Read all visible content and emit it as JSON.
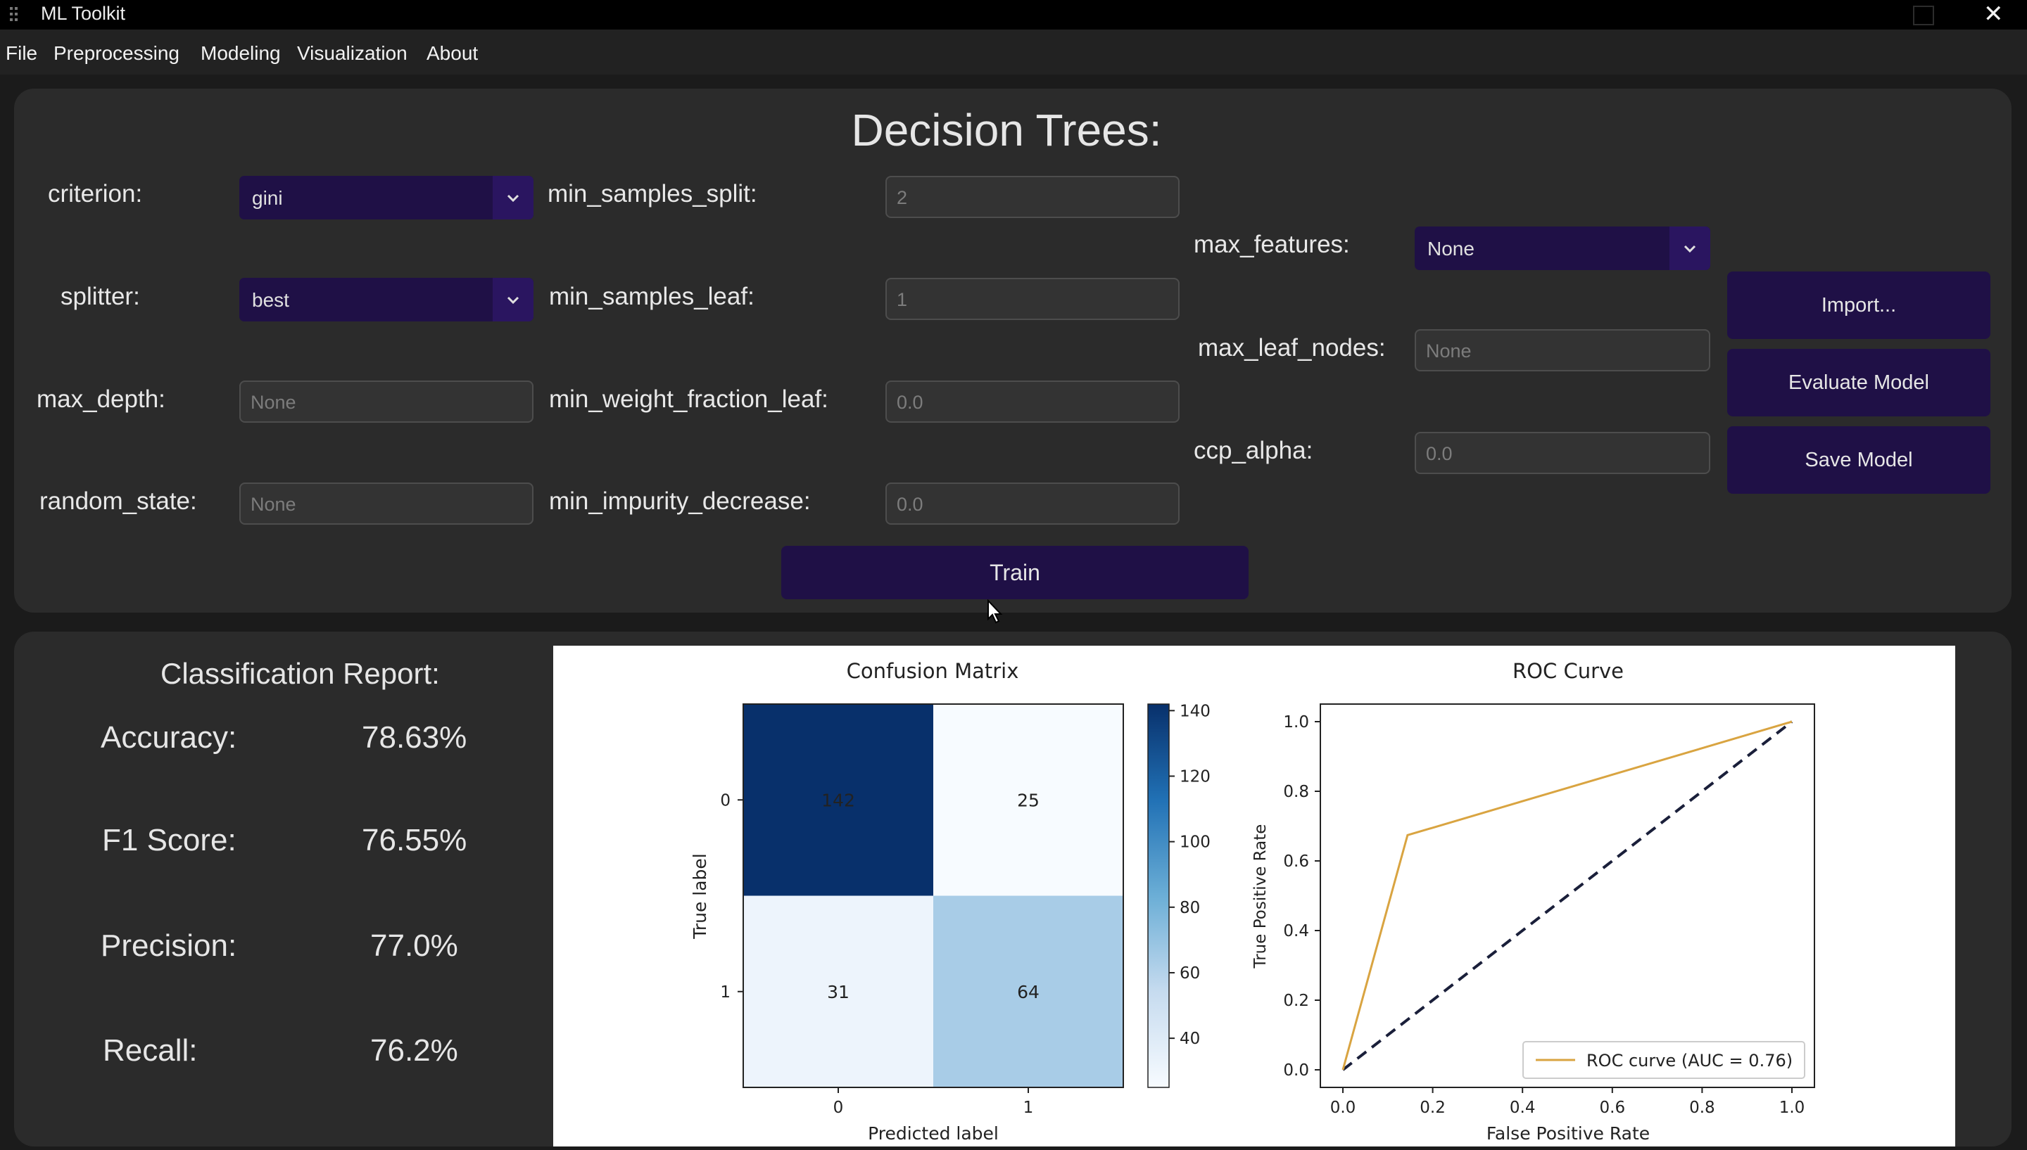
{
  "window": {
    "title": "ML Toolkit",
    "close_glyph": "✕"
  },
  "menu": [
    "File",
    "Preprocessing",
    "Modeling",
    "Visualization",
    "About"
  ],
  "form": {
    "title": "Decision Trees:",
    "labels": {
      "criterion": "criterion:",
      "splitter": "splitter:",
      "max_depth": "max_depth:",
      "random_state": "random_state:",
      "min_samples_split": "min_samples_split:",
      "min_samples_leaf": "min_samples_leaf:",
      "min_weight_fraction_leaf": "min_weight_fraction_leaf:",
      "min_impurity_decrease": "min_impurity_decrease:",
      "max_features": "max_features:",
      "max_leaf_nodes": "max_leaf_nodes:",
      "ccp_alpha": "ccp_alpha:"
    },
    "values": {
      "criterion": "gini",
      "splitter": "best",
      "max_depth": "None",
      "random_state": "None",
      "min_samples_split": "2",
      "min_samples_leaf": "1",
      "min_weight_fraction_leaf": "0.0",
      "min_impurity_decrease": "0.0",
      "max_features": "None",
      "max_leaf_nodes": "None",
      "ccp_alpha": "0.0"
    },
    "buttons": {
      "import": "Import...",
      "evaluate": "Evaluate Model",
      "save": "Save Model",
      "train": "Train"
    }
  },
  "report": {
    "title": "Classification Report:",
    "metrics": [
      {
        "label": "Accuracy:",
        "value": "78.63%"
      },
      {
        "label": "F1 Score:",
        "value": "76.55%"
      },
      {
        "label": "Precision:",
        "value": "77.0%"
      },
      {
        "label": "Recall:",
        "value": "76.2%"
      }
    ]
  },
  "colors": {
    "button_bg": "#1f1046",
    "panel_bg": "#2b2b2b",
    "roc_line": "#d9a441"
  },
  "chart_data": [
    {
      "type": "heatmap",
      "title": "Confusion Matrix",
      "xlabel": "Predicted label",
      "ylabel": "True label",
      "x_categories": [
        "0",
        "1"
      ],
      "y_categories": [
        "0",
        "1"
      ],
      "values": [
        [
          142,
          25
        ],
        [
          31,
          64
        ]
      ],
      "colorbar_ticks": [
        40,
        60,
        80,
        100,
        120,
        140
      ],
      "colormap": "Blues"
    },
    {
      "type": "line",
      "title": "ROC Curve",
      "xlabel": "False Positive Rate",
      "ylabel": "True Positive Rate",
      "xlim": [
        0.0,
        1.0
      ],
      "ylim": [
        0.0,
        1.0
      ],
      "x_ticks": [
        "0.0",
        "0.2",
        "0.4",
        "0.6",
        "0.8",
        "1.0"
      ],
      "y_ticks": [
        "0.0",
        "0.2",
        "0.4",
        "0.6",
        "0.8",
        "1.0"
      ],
      "series": [
        {
          "name": "ROC curve (AUC = 0.76)",
          "x": [
            0.0,
            0.144,
            1.0
          ],
          "y": [
            0.0,
            0.674,
            1.0
          ],
          "style": "solid",
          "color": "#d9a441"
        },
        {
          "x": [
            0.0,
            1.0
          ],
          "y": [
            0.0,
            1.0
          ],
          "style": "dashed",
          "color": "#1a1f3a"
        }
      ],
      "legend": "lower right"
    }
  ]
}
